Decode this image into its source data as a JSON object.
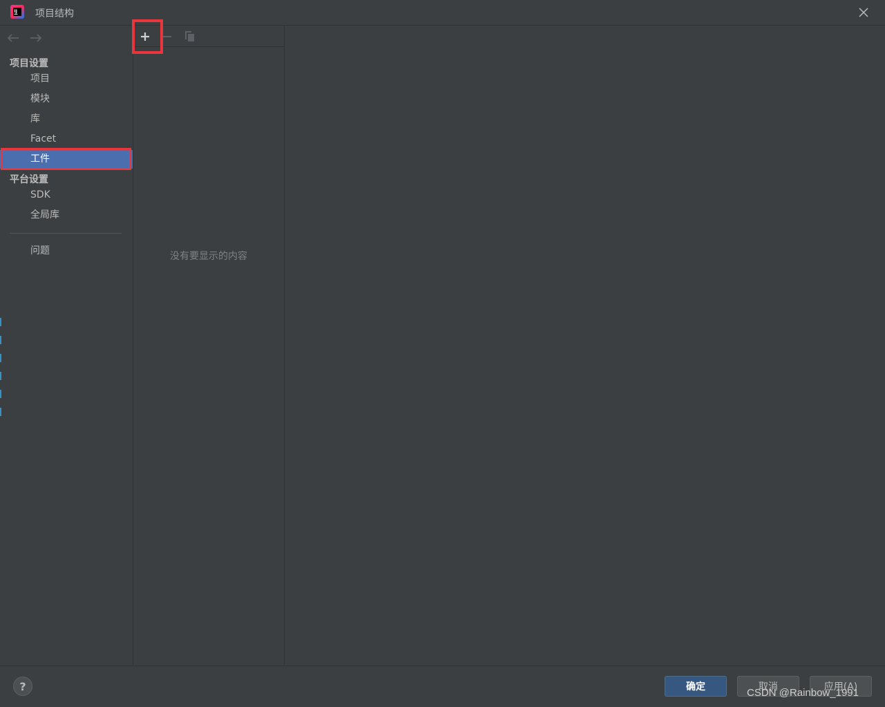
{
  "window": {
    "title": "项目结构",
    "logo_icon": "intellij-idea-icon",
    "close_icon": "close-icon"
  },
  "sidebar": {
    "nav_back_icon": "arrow-left-icon",
    "nav_forward_icon": "arrow-right-icon",
    "sections": [
      {
        "header": "项目设置",
        "items": [
          "项目",
          "模块",
          "库",
          "Facet",
          "工件"
        ]
      },
      {
        "header": "平台设置",
        "items": [
          "SDK",
          "全局库"
        ]
      }
    ],
    "problems_label": "问题",
    "selected_item": "工件"
  },
  "middle": {
    "toolbar": {
      "add_icon": "plus-icon",
      "remove_icon": "minus-icon",
      "copy_icon": "copy-icon"
    },
    "empty_text": "没有要显示的内容"
  },
  "footer": {
    "help_label": "?",
    "ok_label": "确定",
    "cancel_label": "取消",
    "apply_label": "应用(A)",
    "watermark": "CSDN @Rainbow_1991"
  },
  "colors": {
    "background": "#3c3f41",
    "selection": "#4b6eaf",
    "highlight_outline": "#e8363c",
    "primary_button": "#365880"
  }
}
